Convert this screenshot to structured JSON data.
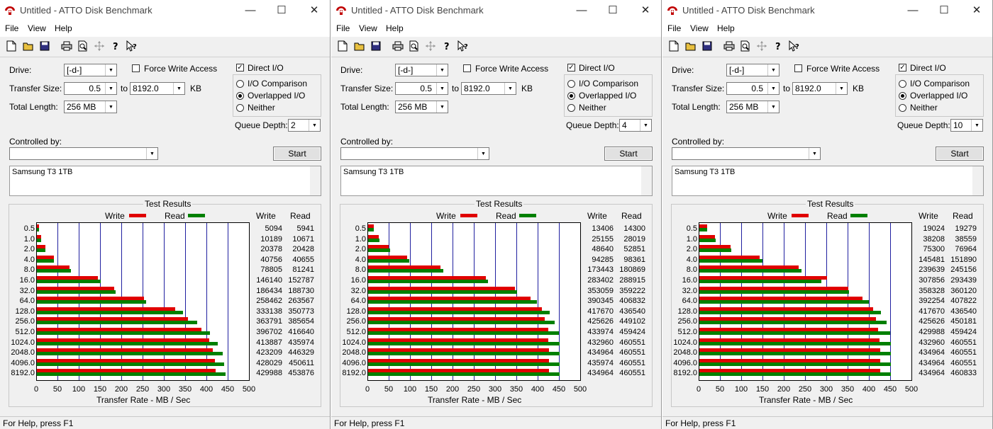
{
  "windows": [
    {
      "title": "Untitled - ATTO Disk Benchmark",
      "menu": [
        "File",
        "View",
        "Help"
      ],
      "drive_label": "Drive:",
      "drive": "[-d-]",
      "force_write_label": "Force Write Access",
      "force_write_checked": false,
      "direct_io_label": "Direct I/O",
      "direct_io_checked": true,
      "transfer_size_label": "Transfer Size:",
      "transfer_from": "0.5",
      "to_label": "to",
      "transfer_to": "8192.0",
      "kb_label": "KB",
      "total_length_label": "Total Length:",
      "total_length": "256 MB",
      "io_options": [
        "I/O Comparison",
        "Overlapped I/O",
        "Neither"
      ],
      "io_selected": "Overlapped I/O",
      "queue_depth_label": "Queue Depth:",
      "queue_depth": "2",
      "controlled_by_label": "Controlled by:",
      "controlled_by": "",
      "start_label": "Start",
      "description": "Samsung T3 1TB",
      "results_title": "Test Results",
      "legend_write": "Write",
      "legend_read": "Read",
      "col_write": "Write",
      "col_read": "Read",
      "xlabel": "Transfer Rate - MB / Sec",
      "status": "For Help, press F1",
      "chart_data": {
        "type": "bar",
        "categories": [
          "0.5",
          "1.0",
          "2.0",
          "4.0",
          "8.0",
          "16.0",
          "32.0",
          "64.0",
          "128.0",
          "256.0",
          "512.0",
          "1024.0",
          "2048.0",
          "4096.0",
          "8192.0"
        ],
        "series": [
          {
            "name": "Write",
            "color": "#e00000",
            "values": [
              5094,
              10189,
              20378,
              40756,
              78805,
              146140,
              186434,
              258462,
              333138,
              363791,
              396702,
              413887,
              423209,
              428029,
              429988
            ]
          },
          {
            "name": "Read",
            "color": "#008000",
            "values": [
              5941,
              10671,
              20428,
              40655,
              81241,
              152787,
              188730,
              263567,
              350773,
              385654,
              416640,
              435974,
              446329,
              450611,
              453876
            ]
          }
        ],
        "value_unit": "KB/s",
        "xlim": [
          0,
          500
        ],
        "xticks": [
          "0",
          "50",
          "100",
          "150",
          "200",
          "250",
          "300",
          "350",
          "400",
          "450",
          "500"
        ],
        "xlabel": "Transfer Rate - MB / Sec"
      }
    },
    {
      "title": "Untitled - ATTO Disk Benchmark",
      "menu": [
        "File",
        "View",
        "Help"
      ],
      "drive_label": "Drive:",
      "drive": "[-d-]",
      "force_write_label": "Force Write Access",
      "force_write_checked": false,
      "direct_io_label": "Direct I/O",
      "direct_io_checked": true,
      "transfer_size_label": "Transfer Size:",
      "transfer_from": "0.5",
      "to_label": "to",
      "transfer_to": "8192.0",
      "kb_label": "KB",
      "total_length_label": "Total Length:",
      "total_length": "256 MB",
      "io_options": [
        "I/O Comparison",
        "Overlapped I/O",
        "Neither"
      ],
      "io_selected": "Overlapped I/O",
      "queue_depth_label": "Queue Depth:",
      "queue_depth": "4",
      "controlled_by_label": "Controlled by:",
      "controlled_by": "",
      "start_label": "Start",
      "description": "Samsung T3 1TB",
      "results_title": "Test Results",
      "legend_write": "Write",
      "legend_read": "Read",
      "col_write": "Write",
      "col_read": "Read",
      "xlabel": "Transfer Rate - MB / Sec",
      "status": "For Help, press F1",
      "chart_data": {
        "type": "bar",
        "categories": [
          "0.5",
          "1.0",
          "2.0",
          "4.0",
          "8.0",
          "16.0",
          "32.0",
          "64.0",
          "128.0",
          "256.0",
          "512.0",
          "1024.0",
          "2048.0",
          "4096.0",
          "8192.0"
        ],
        "series": [
          {
            "name": "Write",
            "color": "#e00000",
            "values": [
              13406,
              25155,
              48640,
              94285,
              173443,
              283402,
              353059,
              390345,
              417670,
              425626,
              433974,
              432960,
              434964,
              435974,
              434964
            ]
          },
          {
            "name": "Read",
            "color": "#008000",
            "values": [
              14300,
              28019,
              52851,
              98361,
              180869,
              288915,
              359222,
              406832,
              436540,
              449102,
              459424,
              460551,
              460551,
              460551,
              460551
            ]
          }
        ],
        "value_unit": "KB/s",
        "xlim": [
          0,
          500
        ],
        "xticks": [
          "0",
          "50",
          "100",
          "150",
          "200",
          "250",
          "300",
          "350",
          "400",
          "450",
          "500"
        ],
        "xlabel": "Transfer Rate - MB / Sec"
      }
    },
    {
      "title": "Untitled - ATTO Disk Benchmark",
      "menu": [
        "File",
        "View",
        "Help"
      ],
      "drive_label": "Drive:",
      "drive": "[-d-]",
      "force_write_label": "Force Write Access",
      "force_write_checked": false,
      "direct_io_label": "Direct I/O",
      "direct_io_checked": true,
      "transfer_size_label": "Transfer Size:",
      "transfer_from": "0.5",
      "to_label": "to",
      "transfer_to": "8192.0",
      "kb_label": "KB",
      "total_length_label": "Total Length:",
      "total_length": "256 MB",
      "io_options": [
        "I/O Comparison",
        "Overlapped I/O",
        "Neither"
      ],
      "io_selected": "Overlapped I/O",
      "queue_depth_label": "Queue Depth:",
      "queue_depth": "10",
      "controlled_by_label": "Controlled by:",
      "controlled_by": "",
      "start_label": "Start",
      "description": "Samsung T3 1TB",
      "results_title": "Test Results",
      "legend_write": "Write",
      "legend_read": "Read",
      "col_write": "Write",
      "col_read": "Read",
      "xlabel": "Transfer Rate - MB / Sec",
      "status": "For Help, press F1",
      "chart_data": {
        "type": "bar",
        "categories": [
          "0.5",
          "1.0",
          "2.0",
          "4.0",
          "8.0",
          "16.0",
          "32.0",
          "64.0",
          "128.0",
          "256.0",
          "512.0",
          "1024.0",
          "2048.0",
          "4096.0",
          "8192.0"
        ],
        "series": [
          {
            "name": "Write",
            "color": "#e00000",
            "values": [
              19024,
              38208,
              75300,
              145481,
              239639,
              307856,
              358328,
              392254,
              417670,
              425626,
              429988,
              432960,
              434964,
              434964,
              434964
            ]
          },
          {
            "name": "Read",
            "color": "#008000",
            "values": [
              19279,
              38559,
              76964,
              151890,
              245156,
              293439,
              360120,
              407822,
              436540,
              450181,
              459424,
              460551,
              460551,
              460551,
              460833
            ]
          }
        ],
        "value_unit": "KB/s",
        "xlim": [
          0,
          500
        ],
        "xticks": [
          "0",
          "50",
          "100",
          "150",
          "200",
          "250",
          "300",
          "350",
          "400",
          "450",
          "500"
        ],
        "xlabel": "Transfer Rate - MB / Sec"
      }
    }
  ]
}
